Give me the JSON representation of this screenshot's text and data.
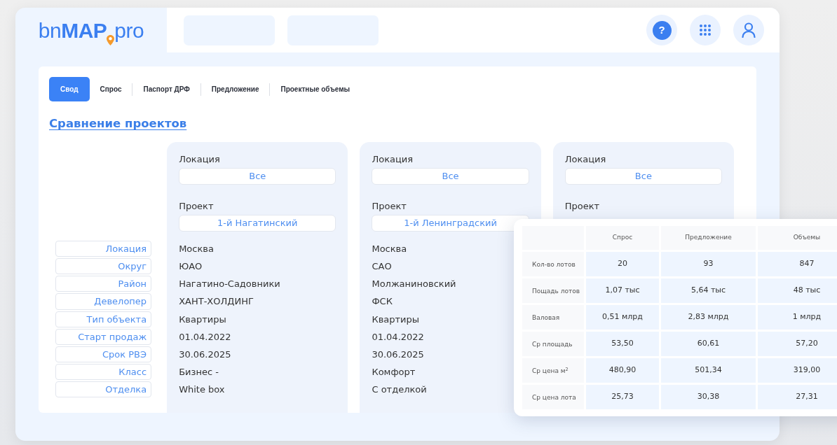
{
  "logo": {
    "name": "bn**MAP**",
    "suffix": "pro"
  },
  "header": {
    "help": "?"
  },
  "tabs": [
    {
      "label": "Свод",
      "selected": true
    },
    {
      "label": "Спрос",
      "selected": false
    },
    {
      "label": "Паспорт ДРФ",
      "selected": false
    },
    {
      "label": "Предложение",
      "selected": false
    },
    {
      "label": "Проектные объемы",
      "selected": false
    }
  ],
  "title": "Сравнение проектов",
  "row_labels": [
    "Локация",
    "Округ",
    "Район",
    "Девелопер",
    "Тип объекта",
    "Старт продаж",
    "Срок РВЭ",
    "Класс",
    "Отделка"
  ],
  "projects": [
    {
      "location_label": "Локация",
      "location": "Все",
      "project_label": "Проект",
      "project": "1-й Нагатинский",
      "values": [
        "Москва",
        "ЮАО",
        "Нагатино-Садовники",
        "ХАНТ-ХОЛДИНГ",
        "Квартиры",
        "01.04.2022",
        "30.06.2025",
        "Бизнес -",
        "White box"
      ]
    },
    {
      "location_label": "Локация",
      "location": "Все",
      "project_label": "Проект",
      "project": "1-й Ленинградский",
      "values": [
        "Москва",
        "САО",
        "Молжаниновский",
        "ФСК",
        "Квартиры",
        "01.04.2022",
        "30.06.2025",
        "Комфорт",
        "С отделкой"
      ]
    },
    {
      "location_label": "Локация",
      "location": "Все",
      "project_label": "Проект"
    }
  ],
  "comparison": {
    "columns": [
      "Спрос",
      "Предложение",
      "Объемы"
    ],
    "rows": [
      {
        "label": "Кол-во лотов",
        "values": [
          "20",
          "93",
          "847"
        ]
      },
      {
        "label": "Пощадь лотов",
        "values": [
          "1,07 тыс",
          "5,64 тыс",
          "48 тыс"
        ]
      },
      {
        "label": "Валовая",
        "values": [
          "0,51 млрд",
          "2,83 млрд",
          "1 млрд"
        ]
      },
      {
        "label": "Ср площадь",
        "values": [
          "53,50",
          "60,61",
          "57,20"
        ]
      },
      {
        "label": "Ср цена м$^{2}$",
        "values": [
          "480,90",
          "501,34",
          "319,00"
        ]
      },
      {
        "label": "Ср цена лота",
        "values": [
          "25,73",
          "30,38",
          "27,31"
        ]
      }
    ]
  }
}
